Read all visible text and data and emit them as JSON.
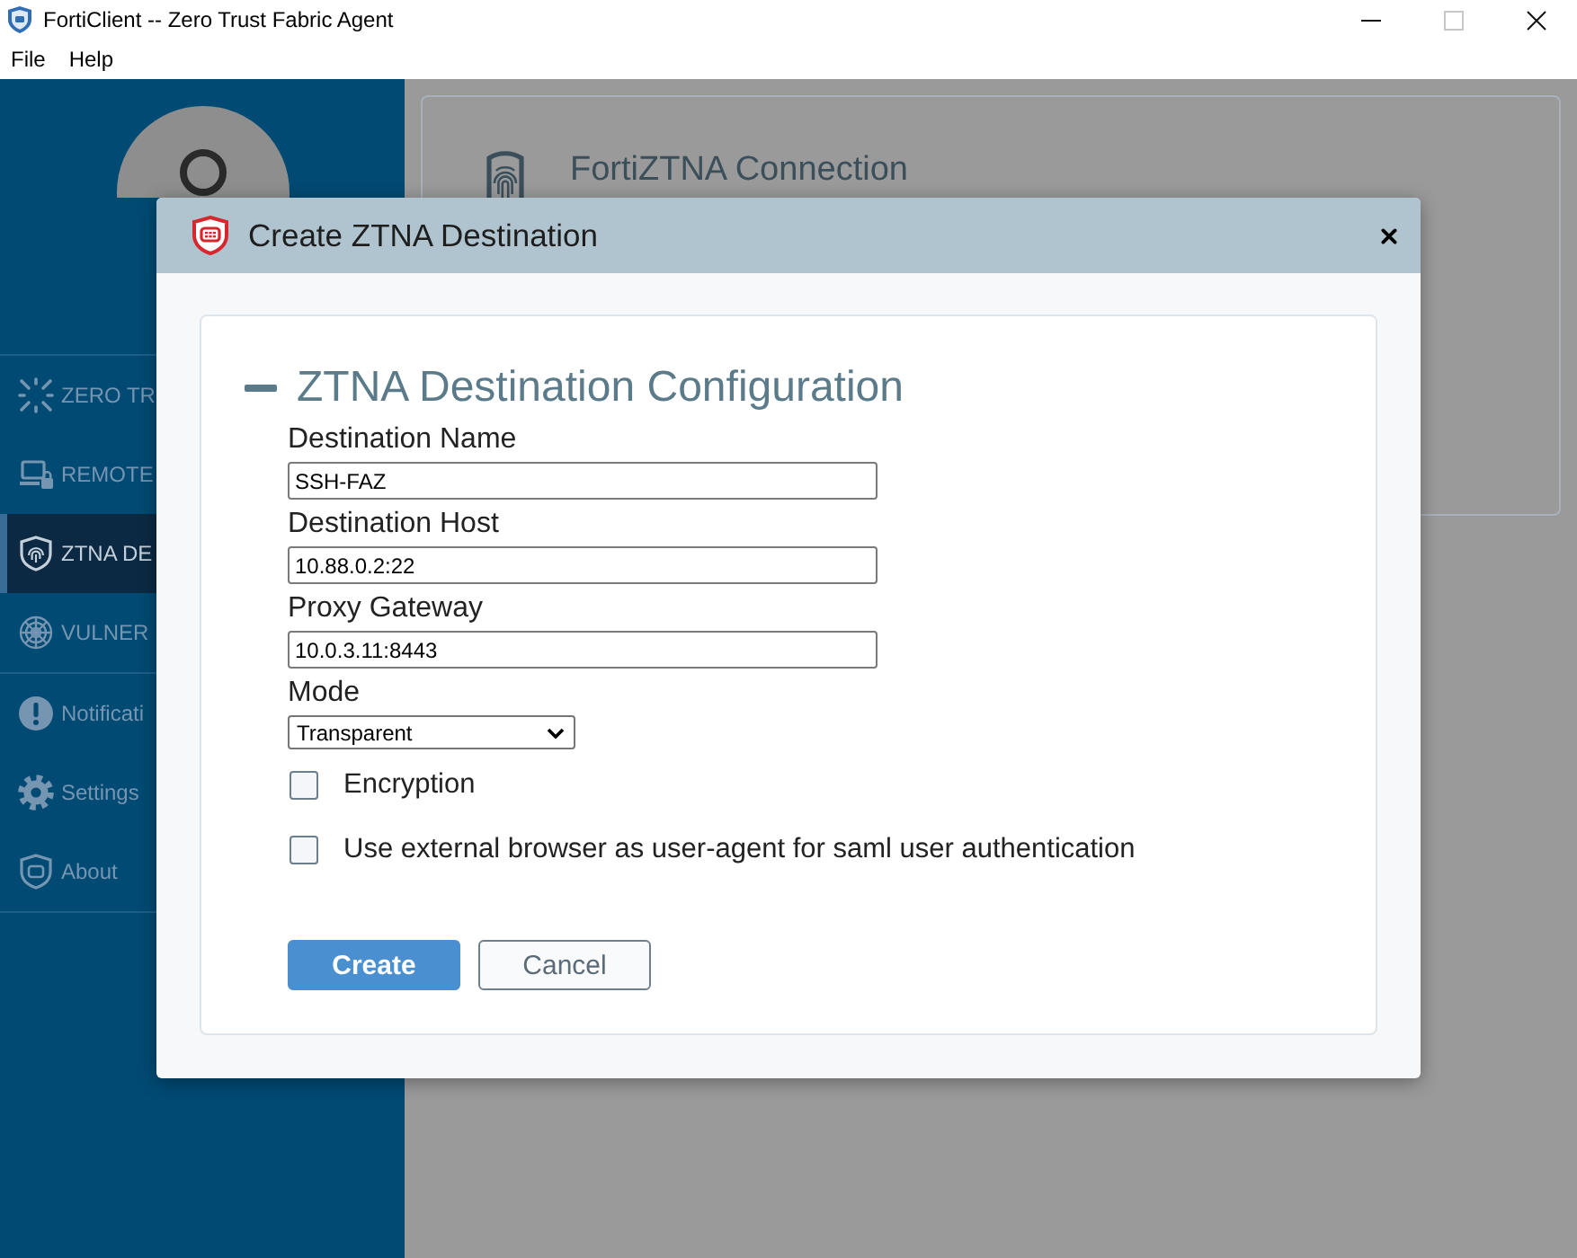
{
  "window": {
    "title": "FortiClient -- Zero Trust Fabric Agent",
    "controls": [
      {
        "kind": "minimize",
        "disabled": false
      },
      {
        "kind": "maximize",
        "disabled": true
      },
      {
        "kind": "close",
        "disabled": false
      }
    ]
  },
  "menu_bar": [
    "File",
    "Help"
  ],
  "sidebar": {
    "groups": [
      {
        "items": [
          {
            "label": "ZERO TR",
            "selected": false
          },
          {
            "label": "REMOTE",
            "selected": false
          },
          {
            "label": "ZTNA DE",
            "selected": true
          },
          {
            "label": "VULNER",
            "selected": false
          }
        ]
      },
      {
        "items": [
          {
            "label": "Notificati",
            "selected": false
          },
          {
            "label": "Settings",
            "selected": false
          },
          {
            "label": "About",
            "selected": false
          }
        ]
      }
    ]
  },
  "main": {
    "card": {
      "title": "FortiZTNA Connection"
    }
  },
  "dialog": {
    "title": "Create ZTNA Destination",
    "section": {
      "title": "ZTNA Destination Configuration",
      "expanded": true,
      "fields": [
        {
          "kind": "text",
          "label": "Destination Name",
          "value": "SSH-FAZ"
        },
        {
          "kind": "text",
          "label": "Destination Host",
          "value": "10.88.0.2:22"
        },
        {
          "kind": "text",
          "label": "Proxy Gateway",
          "value": "10.0.3.11:8443"
        },
        {
          "kind": "select",
          "label": "Mode",
          "value": "Transparent"
        }
      ],
      "checkboxes": [
        {
          "label": "Encryption",
          "checked": false
        },
        {
          "label": "Use external browser as user-agent for saml user authentication",
          "checked": false
        }
      ]
    },
    "buttons": [
      {
        "label": "Create",
        "kind": "primary"
      },
      {
        "label": "Cancel",
        "kind": "secondary"
      }
    ]
  }
}
